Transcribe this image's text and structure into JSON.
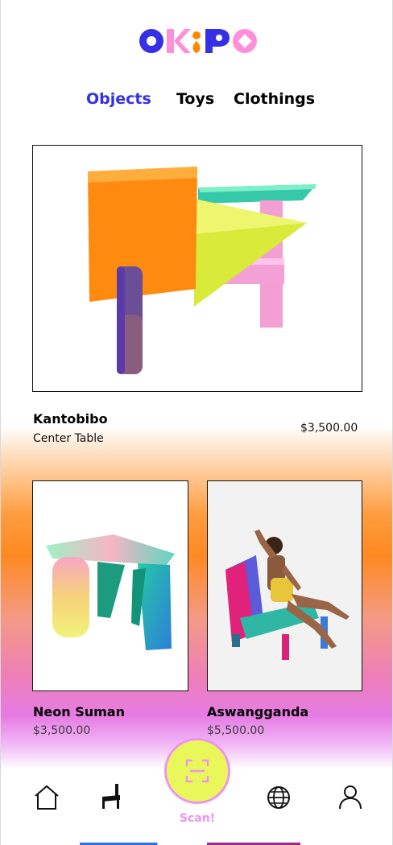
{
  "brand": {
    "logo_text": "OKiPO"
  },
  "tabs": [
    {
      "label": "Objects",
      "active": true
    },
    {
      "label": "Toys",
      "active": false
    },
    {
      "label": "Clothings",
      "active": false
    }
  ],
  "featured": {
    "name": "Kantobibo",
    "subtitle": "Center Table",
    "price": "$3,500.00"
  },
  "products": [
    {
      "name": "Neon Suman",
      "price": "$3,500.00"
    },
    {
      "name": "Aswangganda",
      "price": "$5,500.00"
    }
  ],
  "bottom_nav": {
    "items": [
      "home-icon",
      "chair-icon",
      "scan-icon",
      "globe-icon",
      "profile-icon"
    ],
    "scan_label": "Scan!"
  },
  "colors": {
    "accent_blue": "#3530e6",
    "accent_pink": "#ee93f2",
    "scan_yellow": "#e9f75a",
    "logo_pink": "#ff8fd8",
    "logo_orange": "#ff8a00"
  }
}
